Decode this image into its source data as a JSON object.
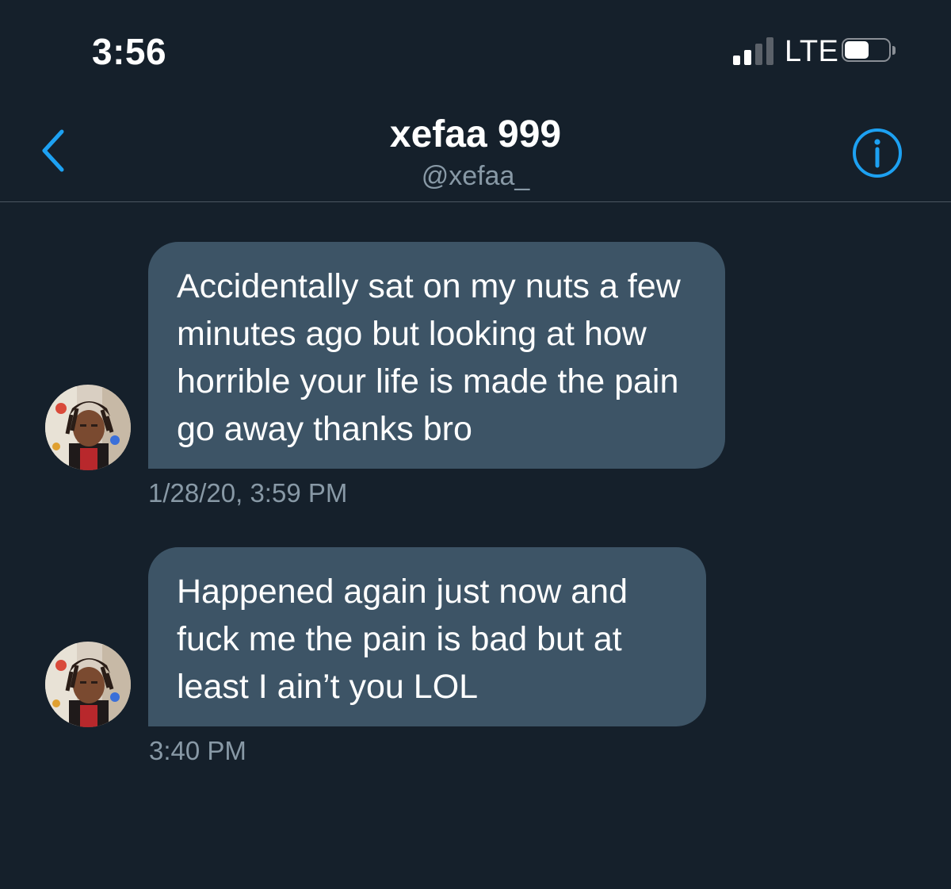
{
  "status_bar": {
    "time": "3:56",
    "network": "LTE",
    "signal_bars_active": 2,
    "signal_bars_total": 4,
    "battery_level": 0.55
  },
  "header": {
    "name": "xefaa 999",
    "handle": "@xefaa_",
    "back_icon": "chevron-left-icon",
    "info_icon": "info-icon"
  },
  "messages": [
    {
      "text": "Accidentally sat on my nuts a few minutes ago but looking at how horrible your life is made the pain go away thanks bro",
      "timestamp": "1/28/20, 3:59 PM"
    },
    {
      "text": "Happened again just now and fuck me the pain is bad but at least I ain’t you LOL",
      "timestamp": "3:40 PM"
    }
  ],
  "colors": {
    "background": "#15202b",
    "bubble": "#3d5466",
    "accent": "#1da1f2",
    "secondary_text": "#8899a6"
  }
}
